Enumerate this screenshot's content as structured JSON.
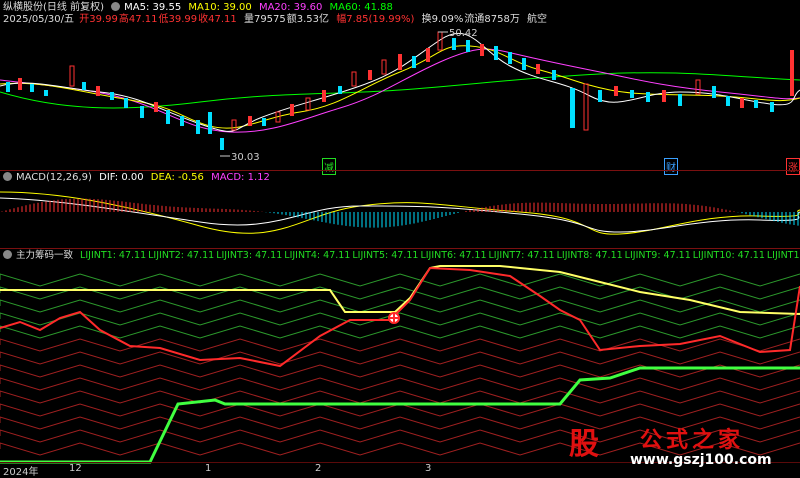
{
  "header": {
    "stock_name": "纵横股份",
    "chart_mode": "(日线 前复权)",
    "ma5": "MA5: 39.55",
    "ma10": "MA10: 39.00",
    "ma20": "MA20: 39.60",
    "ma60": "MA60: 41.88"
  },
  "quote": {
    "date": "2025/05/30/五",
    "open": "开39.99",
    "high": "高47.11",
    "low": "低39.99",
    "close": "收47.11",
    "volume": "量79575",
    "amount": "额3.53亿",
    "change": "幅7.85(19.99%)",
    "turnover": "换9.09%",
    "float_shares": "流通8758万",
    "sector": "航空"
  },
  "price_panel": {
    "high_marker": "50.42",
    "low_marker": "30.03",
    "events": [
      "减",
      "财",
      "涨"
    ]
  },
  "macd_panel": {
    "title": "MACD(12,26,9)",
    "dif": "DIF: 0.00",
    "dea": "DEA: -0.56",
    "macd": "MACD: 1.12"
  },
  "chip_panel": {
    "title": "主力筹码一致",
    "labels": [
      "LIJINT1: 47.11",
      "LIJINT2: 47.11",
      "LIJINT3: 47.11",
      "LIJINT4: 47.11",
      "LIJINT5: 47.11",
      "LIJINT6: 47.11",
      "LIJINT7: 47.11",
      "LIJINT8: 47.11",
      "LIJINT9: 47.11",
      "LIJINT10: 47.11",
      "LIJINT11: 47"
    ]
  },
  "time_axis": {
    "labels": [
      "2024年",
      "12",
      "1",
      "2",
      "3"
    ]
  },
  "watermark": {
    "logo_char": "股",
    "name": "公式之家",
    "url": "www.gszj100.com"
  },
  "colors": {
    "up": "#ff3232",
    "down": "#00e0ff",
    "ma5": "#ffffff",
    "ma10": "#ffff00",
    "ma20": "#ff40ff",
    "ma60": "#00ff00",
    "separator": "#7a1010"
  }
}
